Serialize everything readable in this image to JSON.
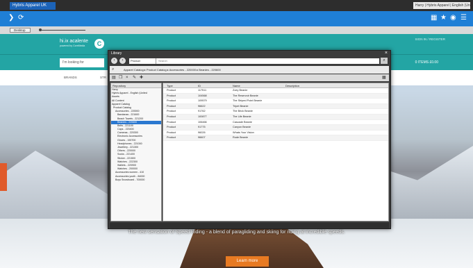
{
  "browser": {
    "tab": "Hybris Apparel UK",
    "right_field": "Harry | Hybris Apparel | English (United"
  },
  "taskbar": {
    "desktop": "Desktop"
  },
  "site": {
    "logo": "hi.ix acalente",
    "logo_sub": "powered by CoreMedia",
    "header_link": "SIGN IN / REGISTER",
    "search_placeholder": "I'm looking for",
    "cart": "0 ITEMS  £0.00",
    "nav": [
      "BRANDS",
      "STR"
    ]
  },
  "hero": {
    "text": "The new sensation of Speed Riding - a blend of paragliding and skiing for riding at incredible speeds.",
    "button": "Learn more"
  },
  "library": {
    "title": "Library",
    "select": "Product",
    "search_placeholder": "Search",
    "breadcrumb": "Apparel Catalog  ▸  Product Catalog  ▸  Accessories - 220000  ▸  Beanies - 220600",
    "tree_header": "Repository",
    "tree": [
      "Harry",
      "Hybris Apparel - English (United",
      "Assets",
      "All Content",
      "Apparel Catalog",
      "Product Catalog",
      "Accessories - 220000",
      "Bandanas - 221600",
      "Beach Towels - 221200",
      "Beanies - 220600",
      "Belts - 221100",
      "Caps - 220400",
      "Cameras - 220300",
      "Electronic Accessories",
      "Gloves - 190700",
      "Headphones - 221000",
      "Jewellery - 221300",
      "Others - 220000",
      "Socks - 221400",
      "Sticker - 221500",
      "Watches - 222300",
      "Wallets - 220900",
      "Watches - 200000",
      "Accessories women - 410",
      "Accessories youth - 84000",
      "Boys Snowboard - 700000"
    ],
    "columns": [
      "Type",
      "ID",
      "Name",
      "Description"
    ],
    "rows": [
      {
        "type": "Product",
        "id": "117511",
        "name": "Zoey Beanie"
      },
      {
        "type": "Product",
        "id": "104568",
        "name": "The Reservoir Beanie"
      },
      {
        "type": "Product",
        "id": "109579",
        "name": "The Striped Point Beanie"
      },
      {
        "type": "Product",
        "id": "96622",
        "name": "Tripet Beanie"
      },
      {
        "type": "Product",
        "id": "91762",
        "name": "The Brick Beanie"
      },
      {
        "type": "Product",
        "id": "100877",
        "name": "The Life Beanie"
      },
      {
        "type": "Product",
        "id": "106466",
        "name": "Cascade Beanie"
      },
      {
        "type": "Product",
        "id": "91775",
        "name": "Canyon Beanie"
      },
      {
        "type": "Product",
        "id": "96026",
        "name": "Whats Your Vision"
      },
      {
        "type": "Product",
        "id": "96607",
        "name": "Rode Beanie"
      }
    ]
  }
}
